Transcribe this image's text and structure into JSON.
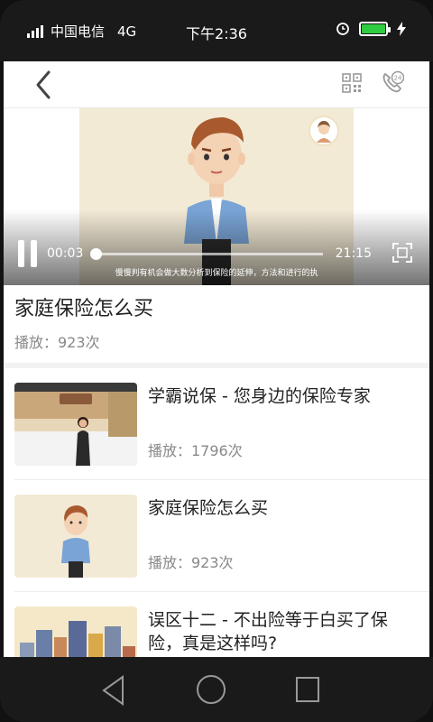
{
  "status_bar": {
    "carrier": "中国电信",
    "network": "4G",
    "time": "下午2:36",
    "battery_color": "#2ecc40"
  },
  "top_bar": {
    "back_icon": "chevron-left-icon",
    "qr_icon": "qr-code-icon",
    "hotline_icon": "phone-24-icon"
  },
  "player": {
    "current_time": "00:03",
    "total_time": "21:15",
    "progress": 0.0,
    "subtitle": "慢慢判有机会做大数分析到保险的延伸，方法和进行的执"
  },
  "video": {
    "title": "家庭保险怎么买",
    "plays": "播放：923次"
  },
  "related": [
    {
      "title": "学霸说保 - 您身边的保险专家",
      "plays": "播放：1796次",
      "thumb": "office-presenter"
    },
    {
      "title": "家庭保险怎么买",
      "plays": "播放：923次",
      "thumb": "cartoon-man"
    },
    {
      "title": "误区十二 - 不出险等于白买了保险，真是这样吗?",
      "plays": "",
      "thumb": "city-skyline"
    }
  ]
}
